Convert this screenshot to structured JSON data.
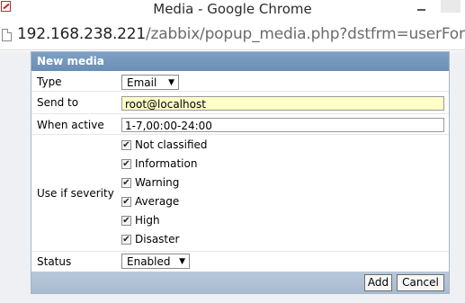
{
  "window": {
    "title": "Media - Google Chrome"
  },
  "address": {
    "host": "192.168.238.221",
    "path": "/zabbix/popup_media.php?dstfrm=userForm"
  },
  "dialog": {
    "title": "New media",
    "type": {
      "label": "Type",
      "value": "Email"
    },
    "send_to": {
      "label": "Send to",
      "value": "root@localhost"
    },
    "when_active": {
      "label": "When active",
      "value": "1-7,00:00-24:00"
    },
    "severity": {
      "label": "Use if severity",
      "options": [
        {
          "label": "Not classified",
          "checked": true
        },
        {
          "label": "Information",
          "checked": true
        },
        {
          "label": "Warning",
          "checked": true
        },
        {
          "label": "Average",
          "checked": true
        },
        {
          "label": "High",
          "checked": true
        },
        {
          "label": "Disaster",
          "checked": true
        }
      ]
    },
    "status": {
      "label": "Status",
      "value": "Enabled"
    },
    "add_label": "Add",
    "cancel_label": "Cancel"
  },
  "colors": {
    "header": "#6a8fb6",
    "send_to_highlight": "#ffffc8"
  }
}
